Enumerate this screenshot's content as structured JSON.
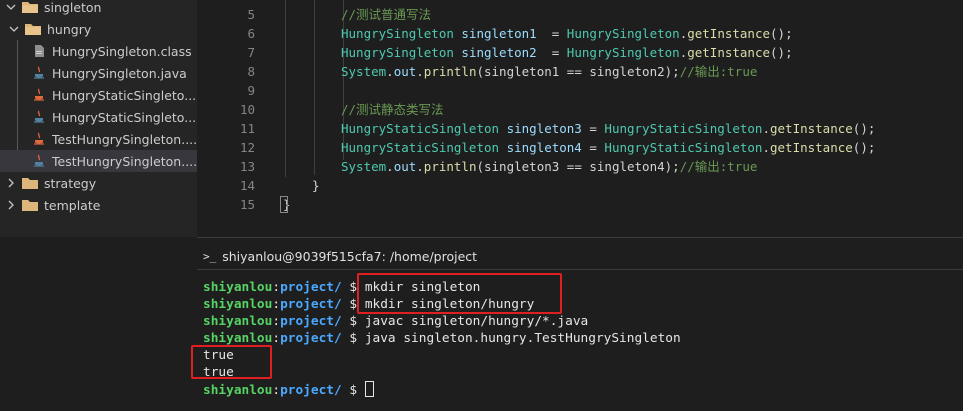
{
  "sidebar": {
    "items": [
      {
        "label": "singleton",
        "type": "folder",
        "expanded": true
      },
      {
        "label": "hungry",
        "type": "folder",
        "expanded": true
      },
      {
        "label": "HungrySingleton.class",
        "type": "class-file"
      },
      {
        "label": "HungrySingleton.java",
        "type": "java-file"
      },
      {
        "label": "HungryStaticSingleto...",
        "type": "java-file"
      },
      {
        "label": "HungryStaticSingleto...",
        "type": "java-file"
      },
      {
        "label": "TestHungrySingleton....",
        "type": "java-file"
      },
      {
        "label": "TestHungrySingleton....",
        "type": "java-file"
      },
      {
        "label": "strategy",
        "type": "folder",
        "expanded": false
      },
      {
        "label": "template",
        "type": "folder",
        "expanded": false
      }
    ]
  },
  "editor": {
    "lines": [
      {
        "num": "5",
        "segs": [
          {
            "t": "//测试普通写法",
            "c": "c-cmt"
          }
        ]
      },
      {
        "num": "6",
        "segs": [
          {
            "t": "HungrySingleton",
            "c": "c-type"
          },
          {
            "t": " ",
            "c": "c-plain"
          },
          {
            "t": "singleton1",
            "c": "c-var"
          },
          {
            "t": "  = ",
            "c": "c-plain"
          },
          {
            "t": "HungrySingleton",
            "c": "c-type"
          },
          {
            "t": ".",
            "c": "c-plain"
          },
          {
            "t": "getInstance",
            "c": "c-fn"
          },
          {
            "t": "();",
            "c": "c-plain"
          }
        ]
      },
      {
        "num": "7",
        "segs": [
          {
            "t": "HungrySingleton",
            "c": "c-type"
          },
          {
            "t": " ",
            "c": "c-plain"
          },
          {
            "t": "singleton2",
            "c": "c-var"
          },
          {
            "t": "  = ",
            "c": "c-plain"
          },
          {
            "t": "HungrySingleton",
            "c": "c-type"
          },
          {
            "t": ".",
            "c": "c-plain"
          },
          {
            "t": "getInstance",
            "c": "c-fn"
          },
          {
            "t": "();",
            "c": "c-plain"
          }
        ]
      },
      {
        "num": "8",
        "segs": [
          {
            "t": "System",
            "c": "c-type"
          },
          {
            "t": ".",
            "c": "c-plain"
          },
          {
            "t": "out",
            "c": "c-var"
          },
          {
            "t": ".",
            "c": "c-plain"
          },
          {
            "t": "println",
            "c": "c-fn"
          },
          {
            "t": "(singleton1 == singleton2);",
            "c": "c-plain"
          },
          {
            "t": "//输出:true",
            "c": "c-cmt"
          }
        ]
      },
      {
        "num": "9",
        "segs": []
      },
      {
        "num": "10",
        "segs": [
          {
            "t": "//测试静态类写法",
            "c": "c-cmt"
          }
        ]
      },
      {
        "num": "11",
        "segs": [
          {
            "t": "HungryStaticSingleton",
            "c": "c-type"
          },
          {
            "t": " ",
            "c": "c-plain"
          },
          {
            "t": "singleton3",
            "c": "c-var"
          },
          {
            "t": " = ",
            "c": "c-plain"
          },
          {
            "t": "HungryStaticSingleton",
            "c": "c-type"
          },
          {
            "t": ".",
            "c": "c-plain"
          },
          {
            "t": "getInstance",
            "c": "c-fn"
          },
          {
            "t": "();",
            "c": "c-plain"
          }
        ]
      },
      {
        "num": "12",
        "segs": [
          {
            "t": "HungryStaticSingleton",
            "c": "c-type"
          },
          {
            "t": " ",
            "c": "c-plain"
          },
          {
            "t": "singleton4",
            "c": "c-var"
          },
          {
            "t": " = ",
            "c": "c-plain"
          },
          {
            "t": "HungryStaticSingleton",
            "c": "c-type"
          },
          {
            "t": ".",
            "c": "c-plain"
          },
          {
            "t": "getInstance",
            "c": "c-fn"
          },
          {
            "t": "();",
            "c": "c-plain"
          }
        ]
      },
      {
        "num": "13",
        "segs": [
          {
            "t": "System",
            "c": "c-type"
          },
          {
            "t": ".",
            "c": "c-plain"
          },
          {
            "t": "out",
            "c": "c-var"
          },
          {
            "t": ".",
            "c": "c-plain"
          },
          {
            "t": "println",
            "c": "c-fn"
          },
          {
            "t": "(singleton3 == singleton4);",
            "c": "c-plain"
          },
          {
            "t": "//输出:true",
            "c": "c-cmt"
          }
        ]
      },
      {
        "num": "14",
        "segs": [
          {
            "t": "}",
            "c": "c-plain"
          }
        ]
      },
      {
        "num": "15",
        "segs": [
          {
            "t": "}",
            "c": "c-plain"
          }
        ]
      }
    ]
  },
  "terminal": {
    "title": "shiyanlou@9039f515cfa7: /home/project",
    "prompt_icon": ">_",
    "lines": [
      {
        "user": "shiyanlou",
        "sep": ":",
        "path": "project/",
        "rest": " $ mkdir singleton"
      },
      {
        "user": "shiyanlou",
        "sep": ":",
        "path": "project/",
        "rest": " $ mkdir singleton/hungry"
      },
      {
        "user": "shiyanlou",
        "sep": ":",
        "path": "project/",
        "rest": " $ javac singleton/hungry/*.java"
      },
      {
        "user": "shiyanlou",
        "sep": ":",
        "path": "project/",
        "rest": " $ java singleton.hungry.TestHungrySingleton"
      },
      {
        "out": "true"
      },
      {
        "out": "true"
      },
      {
        "user": "shiyanlou",
        "sep": ":",
        "path": "project/",
        "rest": " $ ",
        "cursor": true
      }
    ]
  },
  "colors": {
    "type": "#4ec9b0",
    "variable": "#9cdcfe",
    "function": "#dcdcaa",
    "comment": "#6a9955",
    "prompt_user": "#56d364",
    "prompt_path": "#4aa8ff",
    "highlight_box": "#e02020"
  }
}
